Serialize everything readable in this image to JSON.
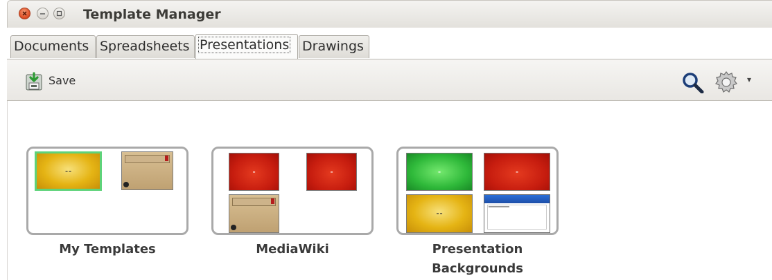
{
  "window": {
    "title": "Template Manager"
  },
  "tabs": [
    {
      "label": "Documents",
      "selected": false
    },
    {
      "label": "Spreadsheets",
      "selected": false
    },
    {
      "label": "Presentations",
      "selected": true
    },
    {
      "label": "Drawings",
      "selected": false
    }
  ],
  "toolbar": {
    "save_label": "Save",
    "icons": [
      "save-icon",
      "search-icon",
      "gear-icon",
      "dropdown-arrow-icon"
    ]
  },
  "folders": [
    {
      "name": "My Templates",
      "thumbnails": [
        "yellow-presentation",
        "beige-presentation"
      ]
    },
    {
      "name": "MediaWiki",
      "thumbnails": [
        "red-presentation",
        "red-presentation",
        "beige-presentation"
      ]
    },
    {
      "name_line1": "Presentation",
      "name_line2": "Backgrounds",
      "thumbnails": [
        "green-presentation",
        "red-presentation",
        "yellow-presentation",
        "blue-presentation"
      ]
    }
  ],
  "colors": {
    "close_button": "#e0532a",
    "folder_frame": "#a9a9a9",
    "selection_border": "#5ed37a",
    "thumb_red": "#c71d0f",
    "thumb_green": "#2fb93a",
    "thumb_yellow": "#e5b414",
    "thumb_blue_header": "#2a6fd8"
  }
}
